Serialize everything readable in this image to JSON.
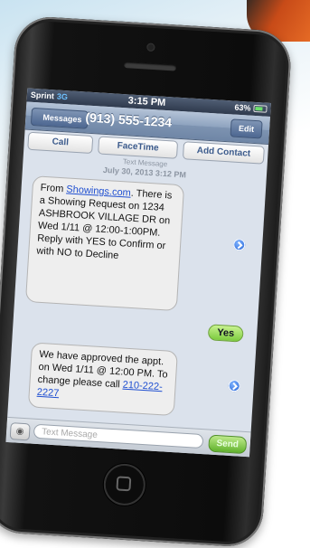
{
  "status": {
    "carrier": "Sprint",
    "network": "3G",
    "time": "3:15 PM",
    "battery": "63%"
  },
  "nav": {
    "back_label": "Messages",
    "title": "(913) 555-1234",
    "edit_label": "Edit"
  },
  "actions": {
    "call": "Call",
    "facetime": "FaceTime",
    "add_contact": "Add Contact"
  },
  "thread": {
    "meta": "Text Message",
    "date": "July 30, 2013 3:12 PM"
  },
  "messages": {
    "incoming_1": {
      "prefix": "From ",
      "link": "Showings.com",
      "body": ". There is a Showing Request on 1234 ASHBROOK VILLAGE DR on Wed 1/11 @ 12:00-1:00PM. Reply with YES to Confirm or with NO to Decline"
    },
    "outgoing_1": "Yes",
    "incoming_2": {
      "body": "We have approved the appt. on Wed 1/11 @ 12:00 PM. To change please call ",
      "phone": "210-222-2227"
    }
  },
  "input": {
    "placeholder": "Text Message",
    "send_label": "Send"
  },
  "icons": {
    "camera": "camera-icon",
    "disclosure": "disclosure-arrow-icon",
    "home": "home-button-icon",
    "battery": "battery-icon"
  }
}
